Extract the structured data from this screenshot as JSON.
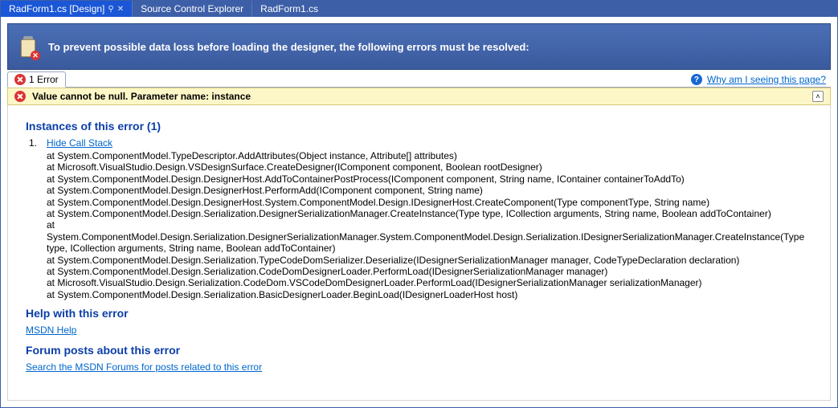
{
  "tabs": [
    {
      "label": "RadForm1.cs [Design]"
    },
    {
      "label": "Source Control Explorer"
    },
    {
      "label": "RadForm1.cs"
    }
  ],
  "banner": {
    "message": "To prevent possible data loss before loading the designer, the following errors must be resolved:"
  },
  "errorsTab": {
    "label": "1 Error"
  },
  "help": {
    "whyLink": "Why am I seeing this page?"
  },
  "error": {
    "message": "Value cannot be null. Parameter name: instance",
    "stack": "at System.ComponentModel.TypeDescriptor.AddAttributes(Object instance, Attribute[] attributes)\nat Microsoft.VisualStudio.Design.VSDesignSurface.CreateDesigner(IComponent component, Boolean rootDesigner)\nat System.ComponentModel.Design.DesignerHost.AddToContainerPostProcess(IComponent component, String name, IContainer containerToAddTo)\nat System.ComponentModel.Design.DesignerHost.PerformAdd(IComponent component, String name)\nat System.ComponentModel.Design.DesignerHost.System.ComponentModel.Design.IDesignerHost.CreateComponent(Type componentType, String name)\nat System.ComponentModel.Design.Serialization.DesignerSerializationManager.CreateInstance(Type type, ICollection arguments, String name, Boolean addToContainer)\nat System.ComponentModel.Design.Serialization.DesignerSerializationManager.System.ComponentModel.Design.Serialization.IDesignerSerializationManager.CreateInstance(Type type, ICollection arguments, String name, Boolean addToContainer)\nat System.ComponentModel.Design.Serialization.TypeCodeDomSerializer.Deserialize(IDesignerSerializationManager manager, CodeTypeDeclaration declaration)\nat System.ComponentModel.Design.Serialization.CodeDomDesignerLoader.PerformLoad(IDesignerSerializationManager manager)\nat Microsoft.VisualStudio.Design.Serialization.CodeDom.VSCodeDomDesignerLoader.PerformLoad(IDesignerSerializationManager serializationManager)\nat System.ComponentModel.Design.Serialization.BasicDesignerLoader.BeginLoad(IDesignerLoaderHost host)"
  },
  "sections": {
    "instances": {
      "title": "Instances of this error (1)",
      "item_num": "1.",
      "hide_link": "Hide Call Stack"
    },
    "help": {
      "title": "Help with this error",
      "link": "MSDN Help"
    },
    "forum": {
      "title": "Forum posts about this error",
      "link": "Search the MSDN Forums for posts related to this error"
    }
  }
}
